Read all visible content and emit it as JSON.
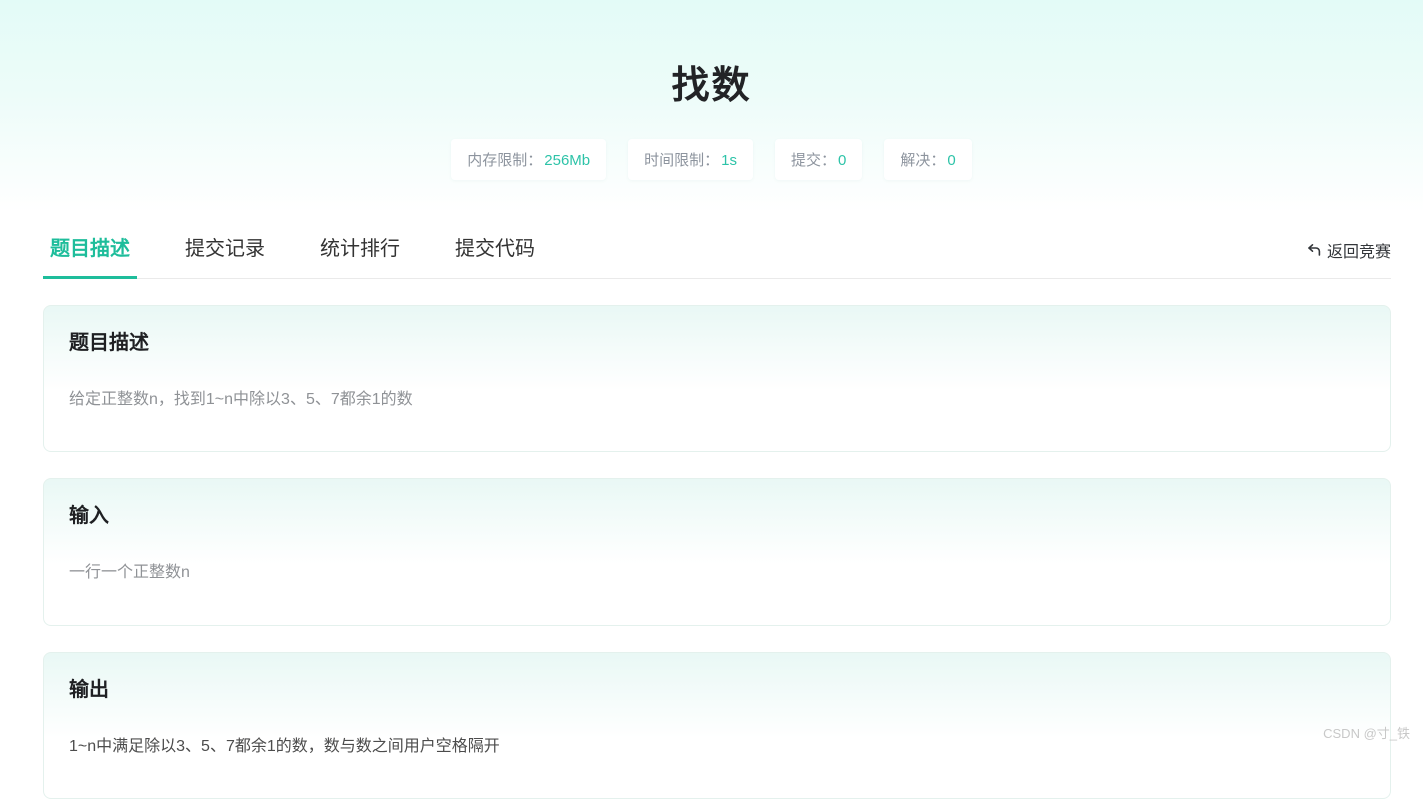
{
  "page": {
    "title": "找数",
    "watermark": "CSDN @寸_铁"
  },
  "colors": {
    "accent_teal": "#1ebd9b",
    "stat_value_teal": "#2dc3a8",
    "hero_gradient_top": "#e3fbf7",
    "card_gradient_top": "#e9f8f5"
  },
  "stats": [
    {
      "label": "内存限制：",
      "value": "256Mb"
    },
    {
      "label": "时间限制：",
      "value": "1s"
    },
    {
      "label": "提交：",
      "value": "0"
    },
    {
      "label": "解决：",
      "value": "0"
    }
  ],
  "tabs": {
    "active_index": 0,
    "items": [
      {
        "label": "题目描述"
      },
      {
        "label": "提交记录"
      },
      {
        "label": "统计排行"
      },
      {
        "label": "提交代码"
      }
    ]
  },
  "back_link": {
    "icon": "return-arrow-icon",
    "label": "返回竞赛"
  },
  "sections": [
    {
      "heading": "题目描述",
      "body": "给定正整数n，找到1~n中除以3、5、7都余1的数"
    },
    {
      "heading": "输入",
      "body": "一行一个正整数n"
    },
    {
      "heading": "输出",
      "body": "1~n中满足除以3、5、7都余1的数，数与数之间用户空格隔开"
    }
  ]
}
